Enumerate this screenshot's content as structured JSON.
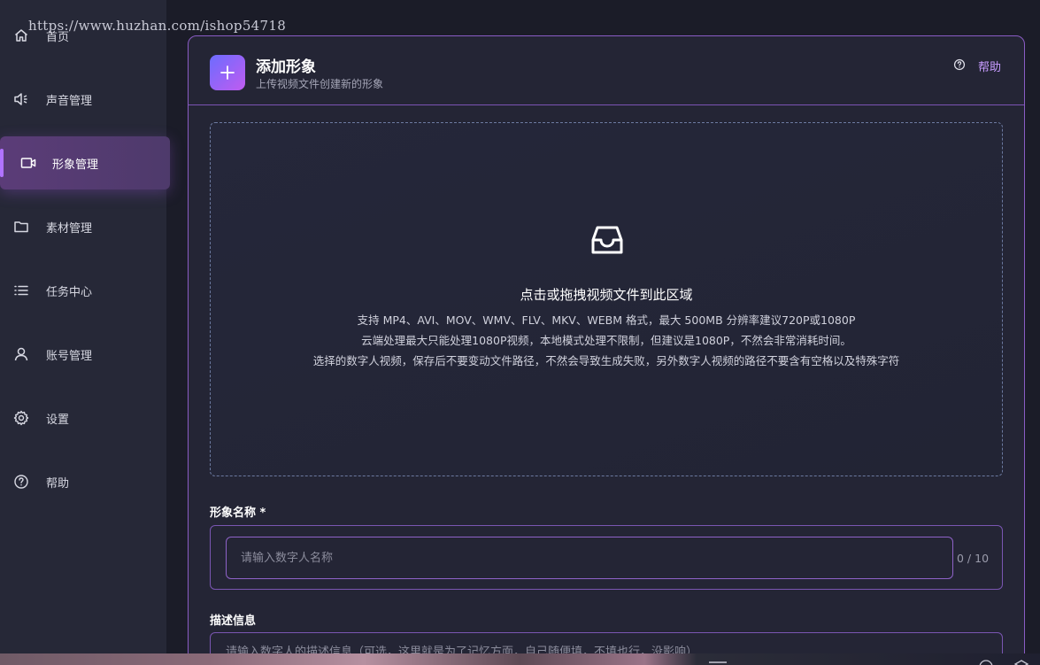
{
  "watermark": "https://www.huzhan.com/ishop54718",
  "sidebar": {
    "items": [
      {
        "label": "首页",
        "icon": "home-icon"
      },
      {
        "label": "声音管理",
        "icon": "speaker-icon"
      },
      {
        "label": "形象管理",
        "icon": "video-icon",
        "active": true
      },
      {
        "label": "素材管理",
        "icon": "folder-icon"
      },
      {
        "label": "任务中心",
        "icon": "list-icon"
      },
      {
        "label": "账号管理",
        "icon": "user-icon"
      },
      {
        "label": "设置",
        "icon": "gear-icon"
      },
      {
        "label": "帮助",
        "icon": "help-circle-icon"
      }
    ]
  },
  "header": {
    "title": "添加形象",
    "subtitle": "上传视频文件创建新的形象",
    "help_label": "帮助"
  },
  "upload": {
    "main_text": "点击或拖拽视频文件到此区域",
    "hints": [
      "支持 MP4、AVI、MOV、WMV、FLV、MKV、WEBM 格式，最大 500MB 分辨率建议720P或1080P",
      "云端处理最大只能处理1080P视频，本地模式处理不限制，但建议是1080P，不然会非常消耗时间。",
      "选择的数字人视频，保存后不要变动文件路径，不然会导致生成失败，另外数字人视频的路径不要含有空格以及特殊字符"
    ]
  },
  "form": {
    "name_label": "形象名称 *",
    "name_placeholder": "请输入数字人名称",
    "name_value": "",
    "name_counter": "0 / 10",
    "desc_label": "描述信息",
    "desc_placeholder": "请输入数字人的描述信息（可选，这里就是为了记忆方面，自己随便填，不填也行，没影响）"
  },
  "colors": {
    "accent": "#b073ff",
    "border_purple": "#8a5cc4",
    "link": "#c79cff",
    "background": "#1b1c28",
    "sidebar_bg": "#262837",
    "card_bg": "#242535"
  }
}
